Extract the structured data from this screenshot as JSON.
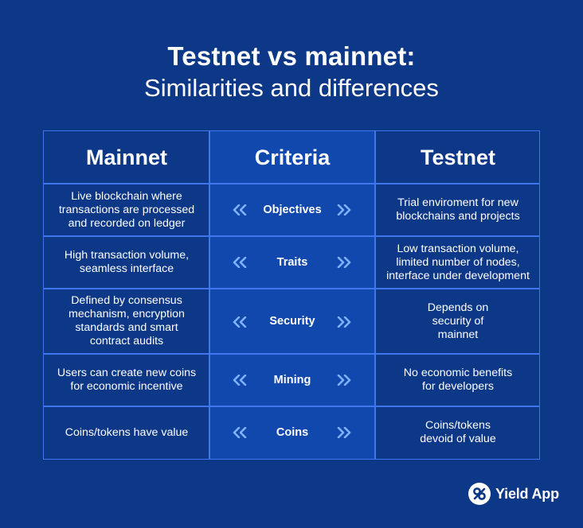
{
  "title": "Testnet vs mainnet:",
  "subtitle": "Similarities and differences",
  "table": {
    "headers": {
      "mainnet": "Mainnet",
      "criteria": "Criteria",
      "testnet": "Testnet"
    },
    "rows": [
      {
        "criteria": "Objectives",
        "mainnet": "Live blockchain where transactions are processed and recorded on ledger",
        "testnet": "Trial enviroment for new blockchains and projects"
      },
      {
        "criteria": "Traits",
        "mainnet": "High transaction volume, seamless interface",
        "testnet": "Low transaction volume, limited number of nodes, interface under development"
      },
      {
        "criteria": "Security",
        "mainnet": "Defined by consensus mechanism, encryption standards and smart contract audits",
        "testnet": "Depends on security of mainnet"
      },
      {
        "criteria": "Mining",
        "mainnet": "Users can create new coins for economic incentive",
        "testnet": "No economic benefits for developers"
      },
      {
        "criteria": "Coins",
        "mainnet": "Coins/tokens have value",
        "testnet": "Coins/tokens devoid of value"
      }
    ]
  },
  "brand": {
    "name": "Yield App",
    "logo_icon": "yield-app-logo-icon"
  },
  "colors": {
    "background": "#0d3787",
    "criteria_column": "#1148ad",
    "grid_lines": "#3f76ee",
    "chevrons": "#7fb1ff",
    "text": "#ffffff"
  }
}
